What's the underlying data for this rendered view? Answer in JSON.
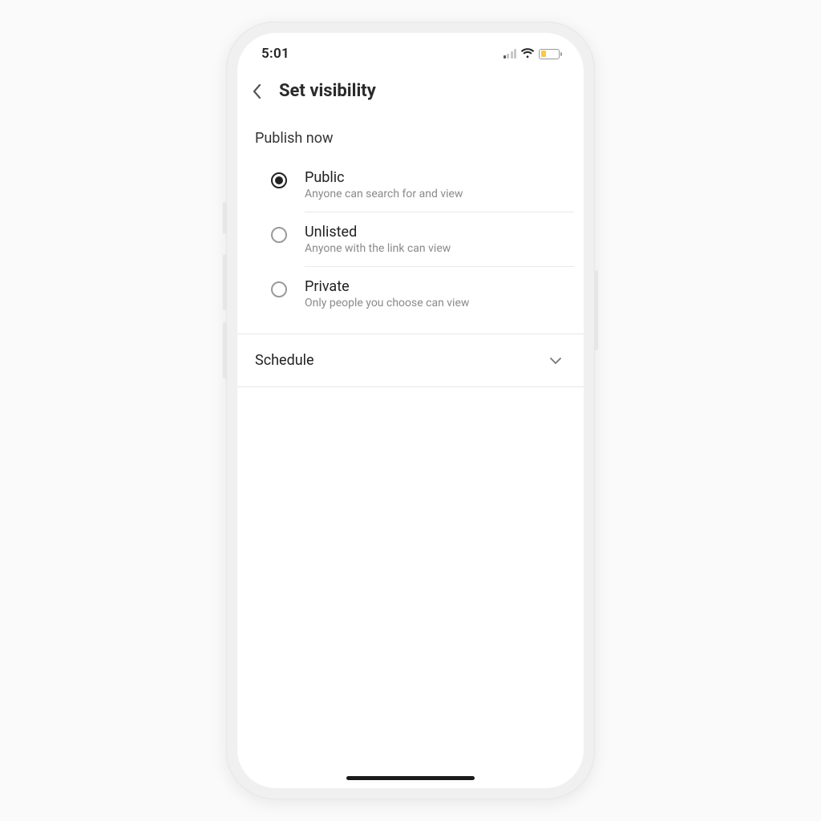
{
  "status_bar": {
    "time": "5:01"
  },
  "header": {
    "title": "Set visibility"
  },
  "publish": {
    "section_label": "Publish now",
    "options": [
      {
        "title": "Public",
        "desc": "Anyone can search for and view",
        "selected": true
      },
      {
        "title": "Unlisted",
        "desc": "Anyone with the link can view",
        "selected": false
      },
      {
        "title": "Private",
        "desc": "Only people you choose can view",
        "selected": false
      }
    ]
  },
  "schedule": {
    "label": "Schedule"
  }
}
